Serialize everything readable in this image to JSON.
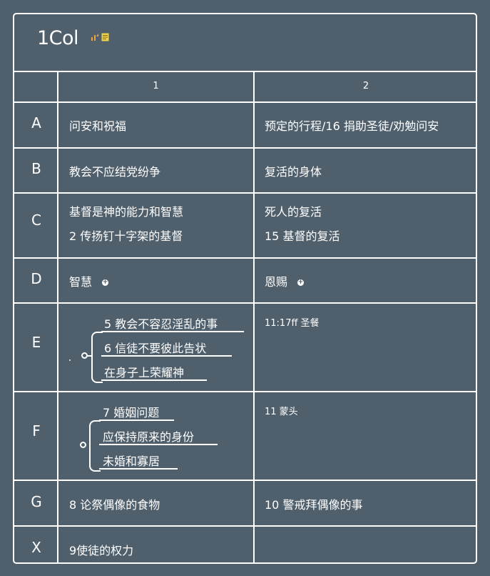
{
  "title": "1Col",
  "title_icons": [
    "chart-up-icon",
    "note-icon"
  ],
  "colors": {
    "background": "#4f5f6c",
    "lines": "#ffffff",
    "icon_orange": "#f4a23a",
    "icon_yellow": "#f3d24a"
  },
  "columns": [
    "1",
    "2"
  ],
  "rows": [
    {
      "label": "A",
      "c1": [
        "问安和祝福"
      ],
      "c2": [
        "预定的行程/16 捐助圣徒/劝勉问安"
      ]
    },
    {
      "label": "B",
      "c1": [
        "教会不应结党纷争"
      ],
      "c2": [
        "复活的身体"
      ]
    },
    {
      "label": "C",
      "c1": [
        "基督是神的能力和智慧",
        "2 传扬钉十字架的基督"
      ],
      "c2": [
        "死人的复活",
        "15 基督的复活"
      ]
    },
    {
      "label": "D",
      "c1": [
        "智慧"
      ],
      "c2": [
        "恩赐"
      ]
    },
    {
      "label": "E",
      "c1_branches": [
        "5 教会不容忍淫乱的事",
        "6 信徒不要彼此告状",
        "在身子上荣耀神"
      ],
      "c2": [
        "11:17ff 圣餐"
      ]
    },
    {
      "label": "F",
      "c1_branches": [
        "7 婚姻问题",
        "应保持原来的身份",
        "未婚和寡居"
      ],
      "c2": [
        "11 蒙头"
      ]
    },
    {
      "label": "G",
      "c1": [
        "8 论祭偶像的食物"
      ],
      "c2": [
        "10 警戒拜偶像的事"
      ]
    },
    {
      "label": "X",
      "c1": [
        "9使徒的权力"
      ],
      "c2": [
        ""
      ]
    }
  ]
}
